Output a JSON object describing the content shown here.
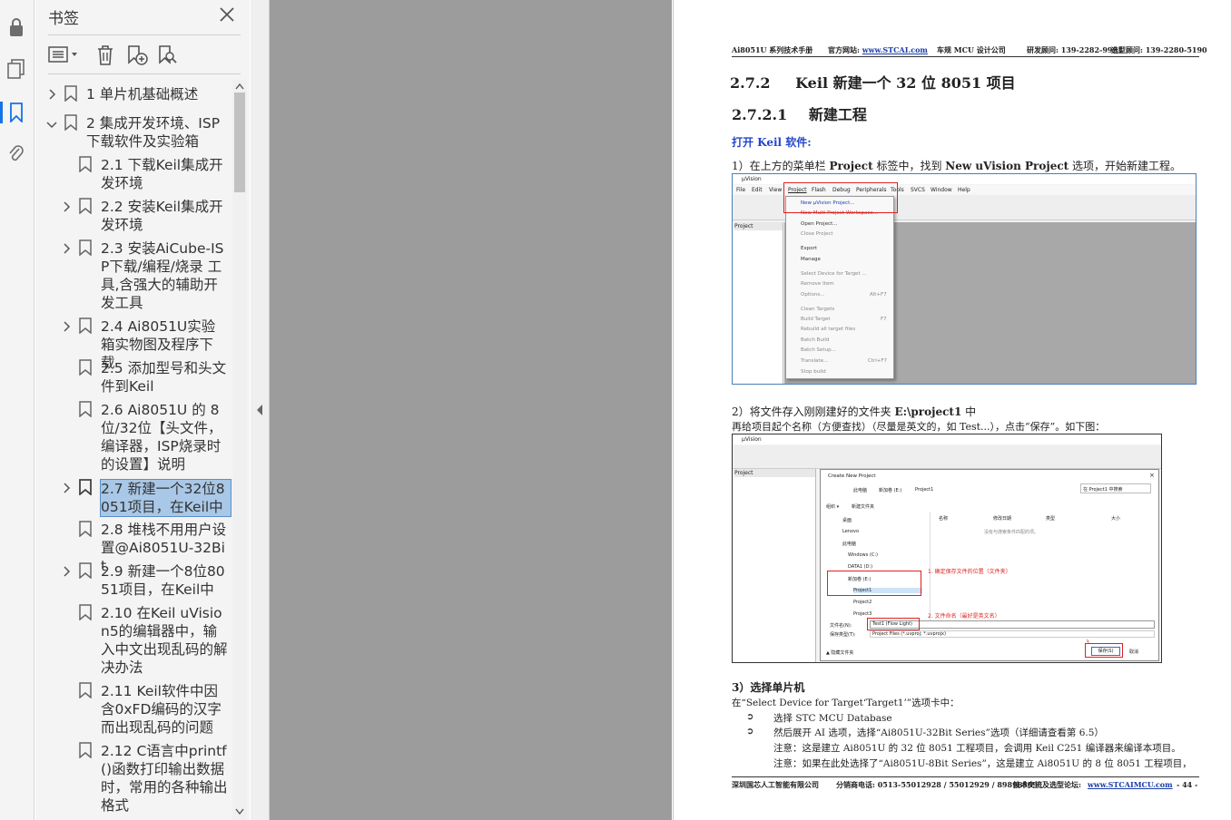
{
  "rail": {
    "icons": [
      "lock-icon",
      "pages-icon",
      "bookmark-icon",
      "attachment-icon"
    ]
  },
  "bookmarks": {
    "title": "书签",
    "items": [
      {
        "label": "1  单片机基础概述",
        "expandable": true,
        "expanded": false,
        "level": 0
      },
      {
        "label": "2  集成开发环境、ISP下载软件及实验箱",
        "expandable": true,
        "expanded": true,
        "level": 0
      },
      {
        "label": "2.1 下载Keil集成开发环境",
        "expandable": false,
        "level": 1
      },
      {
        "label": "2.2  安装Keil集成开发环境",
        "expandable": true,
        "level": 1
      },
      {
        "label": "2.3  安装AiCube-ISP下载/编程/烧录 工具,含强大的辅助开发工具",
        "expandable": true,
        "level": 1
      },
      {
        "label": "2.4  Ai8051U实验箱实物图及程序下载",
        "expandable": true,
        "level": 1
      },
      {
        "label": "2.5  添加型号和头文件到Keil",
        "expandable": false,
        "level": 1
      },
      {
        "label": "2.6  Ai8051U 的 8位/32位【头文件，编译器，ISP烧录时的设置】说明",
        "expandable": false,
        "level": 1
      },
      {
        "label": "2.7 新建一个32位8051项目，在Keil中",
        "expandable": true,
        "level": 1,
        "selected": true
      },
      {
        "label": "2.8  堆栈不用用户设置@Ai8051U-32Bit",
        "expandable": false,
        "level": 1
      },
      {
        "label": "2.9  新建一个8位8051项目，在Keil中",
        "expandable": true,
        "level": 1
      },
      {
        "label": "2.10  在Keil uVision5的编辑器中，输入中文出现乱码的解决办法",
        "expandable": false,
        "level": 1
      },
      {
        "label": "2.11  Keil软件中因含0xFD编码的汉字而出现乱码的问题",
        "expandable": false,
        "level": 1
      },
      {
        "label": "2.12  C语言中printf()函数打印输出数据时，常用的各种输出格式",
        "expandable": false,
        "level": 1
      }
    ]
  },
  "page": {
    "header": {
      "left": "Ai8051U 系列技术手册",
      "site_label": "官方网站: ",
      "site": "www.STCAI.com",
      "company": "车规 MCU 设计公司",
      "consult": "研发顾问: 139-2282-9991",
      "select": "选型顾问: 139-2280-5190"
    },
    "h1_num": "2.7.2",
    "h1_text": "Keil 新建一个 32 位 8051 项目",
    "h2_num": "2.7.2.1",
    "h2_text": "新建工程",
    "open_keil": "打开 Keil 软件:",
    "step1_a": "1）在上方的菜单栏 ",
    "step1_b": "Project",
    "step1_c": " 标签中，找到 ",
    "step1_d": "New uVision Project",
    "step1_e": " 选项，开始新建工程。",
    "step2_a": "2）将文件存入刚刚建好的文件夹 ",
    "step2_b": "E:\\project1",
    "step2_c": " 中",
    "step2_desc": "再给项目起个名称（方便查找）（尽量是英文的，如 Test...），点击“保存”。如下图：",
    "step3": "3）选择单片机",
    "step3_desc": "在“Select Device for Target‘Target1’”选项卡中：",
    "b1": "选择 STC MCU Database",
    "b2": "然后展开 AI 选项，选择“Ai8051U-32Bit Series”选项（详细请查看第 6.5）",
    "note1": "注意：这是建立 Ai8051U 的 32 位 8051 工程项目，会调用 Keil C251 编译器来编译本项目。",
    "note2": "注意：如果在此处选择了“Ai8051U-8Bit Series”，这是建立 Ai8051U 的 8 位 8051 工程项目，",
    "footer": {
      "company": "深圳国芯人工智能有限公司",
      "phone": "分销商电话: 0513-55012928 / 55012929 / 89896509",
      "forum_label": "技术交流及选型论坛:",
      "forum": "www.STCAIMCU.com",
      "page": "- 44 -"
    },
    "shot1": {
      "title": "µVision",
      "menu": [
        "File",
        "Edit",
        "View",
        "Project",
        "Flash",
        "Debug",
        "Peripherals",
        "Tools",
        "SVCS",
        "Window",
        "Help"
      ],
      "project_pane": "Project",
      "dropdown": [
        "New µVision Project...",
        "New Multi-Project Workspace...",
        "Open Project...",
        "Close Project",
        "Export",
        "Manage",
        "Select Device for Target ...",
        "Remove Item",
        "Options...",
        "Clean Targets",
        "Build Target",
        "Rebuild all target files",
        "Batch Build",
        "Batch Setup...",
        "Translate...",
        "Stop build"
      ],
      "shortcuts": {
        "options": "Alt+F7",
        "build": "F7",
        "translate": "Ctrl+F7"
      }
    },
    "shot2": {
      "title": "µVision",
      "dialog_title": "Create New Project",
      "path": [
        "此电脑",
        "新加卷 (E:)",
        "Project1"
      ],
      "search": "在 Project1 中搜索",
      "organize": "组织 ▾",
      "new_folder": "新建文件夹",
      "columns": [
        "名称",
        "修改日期",
        "类型",
        "大小"
      ],
      "empty": "没有与搜索条件匹配的项。",
      "tree": [
        "桌面",
        "Lenovo",
        "此电脑",
        "Windows (C:)",
        "DATA1 (D:)",
        "新加卷 (E:)",
        "Project1",
        "Project2",
        "Project3"
      ],
      "filename_label": "文件名(N):",
      "filename": "Test1 (Flow Light)",
      "filetype_label": "保存类型(T):",
      "filetype": "Project Files (*.uvproj; *.uvprojx)",
      "hide": "▲ 隐藏文件夹",
      "save": "保存(S)",
      "cancel": "取消",
      "note1": "1. 确定保存文件的位置（文件夹）",
      "note2": "2. 文件命名（最好是英文名）",
      "note3": "3"
    }
  }
}
